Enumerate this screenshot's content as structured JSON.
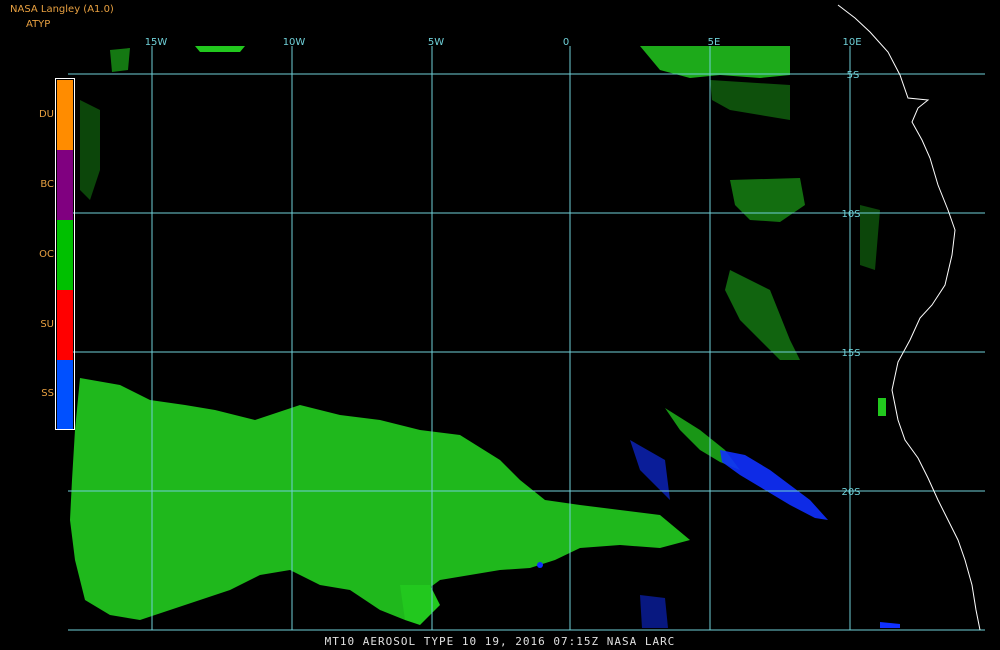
{
  "header": {
    "title": "NASA Langley (A1.0)",
    "subtitle": "ATYP"
  },
  "legend": {
    "items": [
      {
        "label": "DU",
        "color": "#ff8c00"
      },
      {
        "label": "BC",
        "color": "#800080"
      },
      {
        "label": "OC",
        "color": "#00c000"
      },
      {
        "label": "SU",
        "color": "#ff0000"
      },
      {
        "label": "SS",
        "color": "#0050ff"
      }
    ]
  },
  "map": {
    "longitude_labels": [
      "15W",
      "10W",
      "5W",
      "0",
      "5E",
      "10E"
    ],
    "latitude_labels": [
      "5S",
      "10S",
      "15S",
      "20S"
    ],
    "grid_color": "#6fd0d8",
    "coastline_color": "#ffffff"
  },
  "footer": {
    "text": "MT10  AEROSOL TYPE  10 19, 2016 07:15Z  NASA LARC"
  }
}
